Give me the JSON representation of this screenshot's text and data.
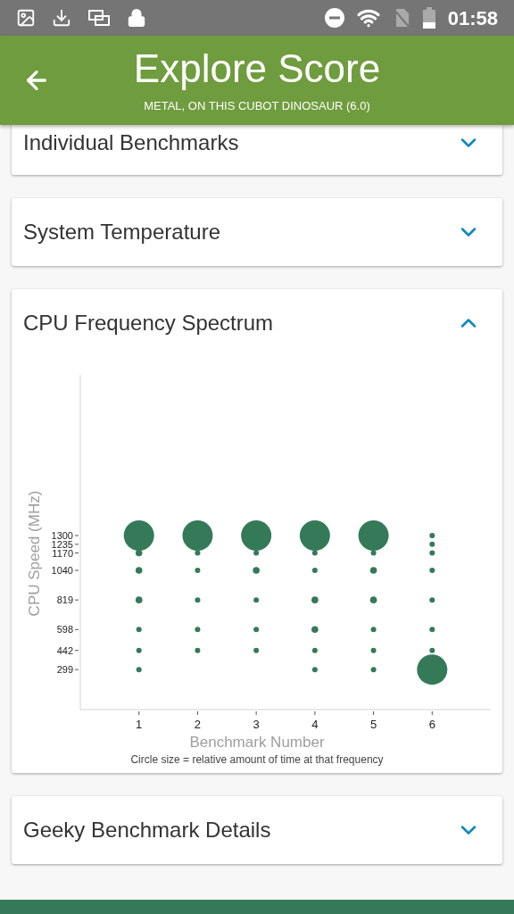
{
  "status_bar": {
    "time": "01:58"
  },
  "header": {
    "title": "Explore Score",
    "subtitle": "METAL, ON THIS CUBOT DINOSAUR (6.0)"
  },
  "sections": [
    {
      "title": "Individual Benchmarks",
      "expanded": false
    },
    {
      "title": "System Temperature",
      "expanded": false
    },
    {
      "title": "CPU Frequency Spectrum",
      "expanded": true,
      "chart_data": {
        "type": "scatter",
        "xlabel": "Benchmark Number",
        "ylabel": "CPU Speed (MHz)",
        "x": [
          1,
          2,
          3,
          4,
          5,
          6
        ],
        "xlim": [
          0,
          7
        ],
        "ylim": [
          0,
          2500
        ],
        "xticks": [
          1,
          2,
          3,
          4,
          5,
          6
        ],
        "yticks": [
          299,
          442,
          598,
          819,
          1040,
          1170,
          1235,
          1300
        ],
        "series": [
          {
            "color": "#357a58",
            "values": [
              1300,
              1300,
              1300,
              1300,
              1300,
              299
            ]
          },
          {
            "color": "#357a58",
            "values": [
              1170,
              null,
              null,
              819,
              819,
              null
            ]
          },
          {
            "color": "#357a58",
            "values": [
              1040,
              null,
              1040,
              598,
              1040,
              null
            ]
          },
          {
            "color": "#357a58",
            "values": [
              819,
              null,
              null,
              null,
              null,
              null
            ]
          },
          {
            "color": "#357a58",
            "values": [
              null,
              null,
              null,
              null,
              null,
              1300
            ]
          },
          {
            "color": "#357a58",
            "values": [
              null,
              null,
              null,
              null,
              null,
              1235
            ]
          },
          {
            "color": "#357a58",
            "values": [
              null,
              1170,
              1170,
              1170,
              1170,
              1170
            ]
          },
          {
            "color": "#357a58",
            "values": [
              null,
              1040,
              null,
              1040,
              null,
              1040
            ]
          },
          {
            "color": "#357a58",
            "values": [
              null,
              819,
              819,
              null,
              null,
              819
            ]
          },
          {
            "color": "#357a58",
            "values": [
              598,
              598,
              598,
              null,
              598,
              598
            ]
          },
          {
            "color": "#357a58",
            "values": [
              442,
              442,
              442,
              442,
              442,
              442
            ]
          },
          {
            "color": "#357a58",
            "values": [
              299,
              null,
              null,
              299,
              299,
              null
            ]
          }
        ]
      },
      "point_styles": [
        {
          "kind": "bubble"
        },
        {
          "kind": "dot"
        },
        {
          "kind": "dot"
        },
        {
          "kind": "dot"
        },
        {
          "kind": "small"
        },
        {
          "kind": "small"
        },
        {
          "kind": "small"
        },
        {
          "kind": "small"
        },
        {
          "kind": "small"
        },
        {
          "kind": "small"
        },
        {
          "kind": "small"
        },
        {
          "kind": "small"
        }
      ],
      "caption": "Circle size = relative amount of time at that frequency"
    },
    {
      "title": "Geeky Benchmark Details",
      "expanded": false
    }
  ]
}
